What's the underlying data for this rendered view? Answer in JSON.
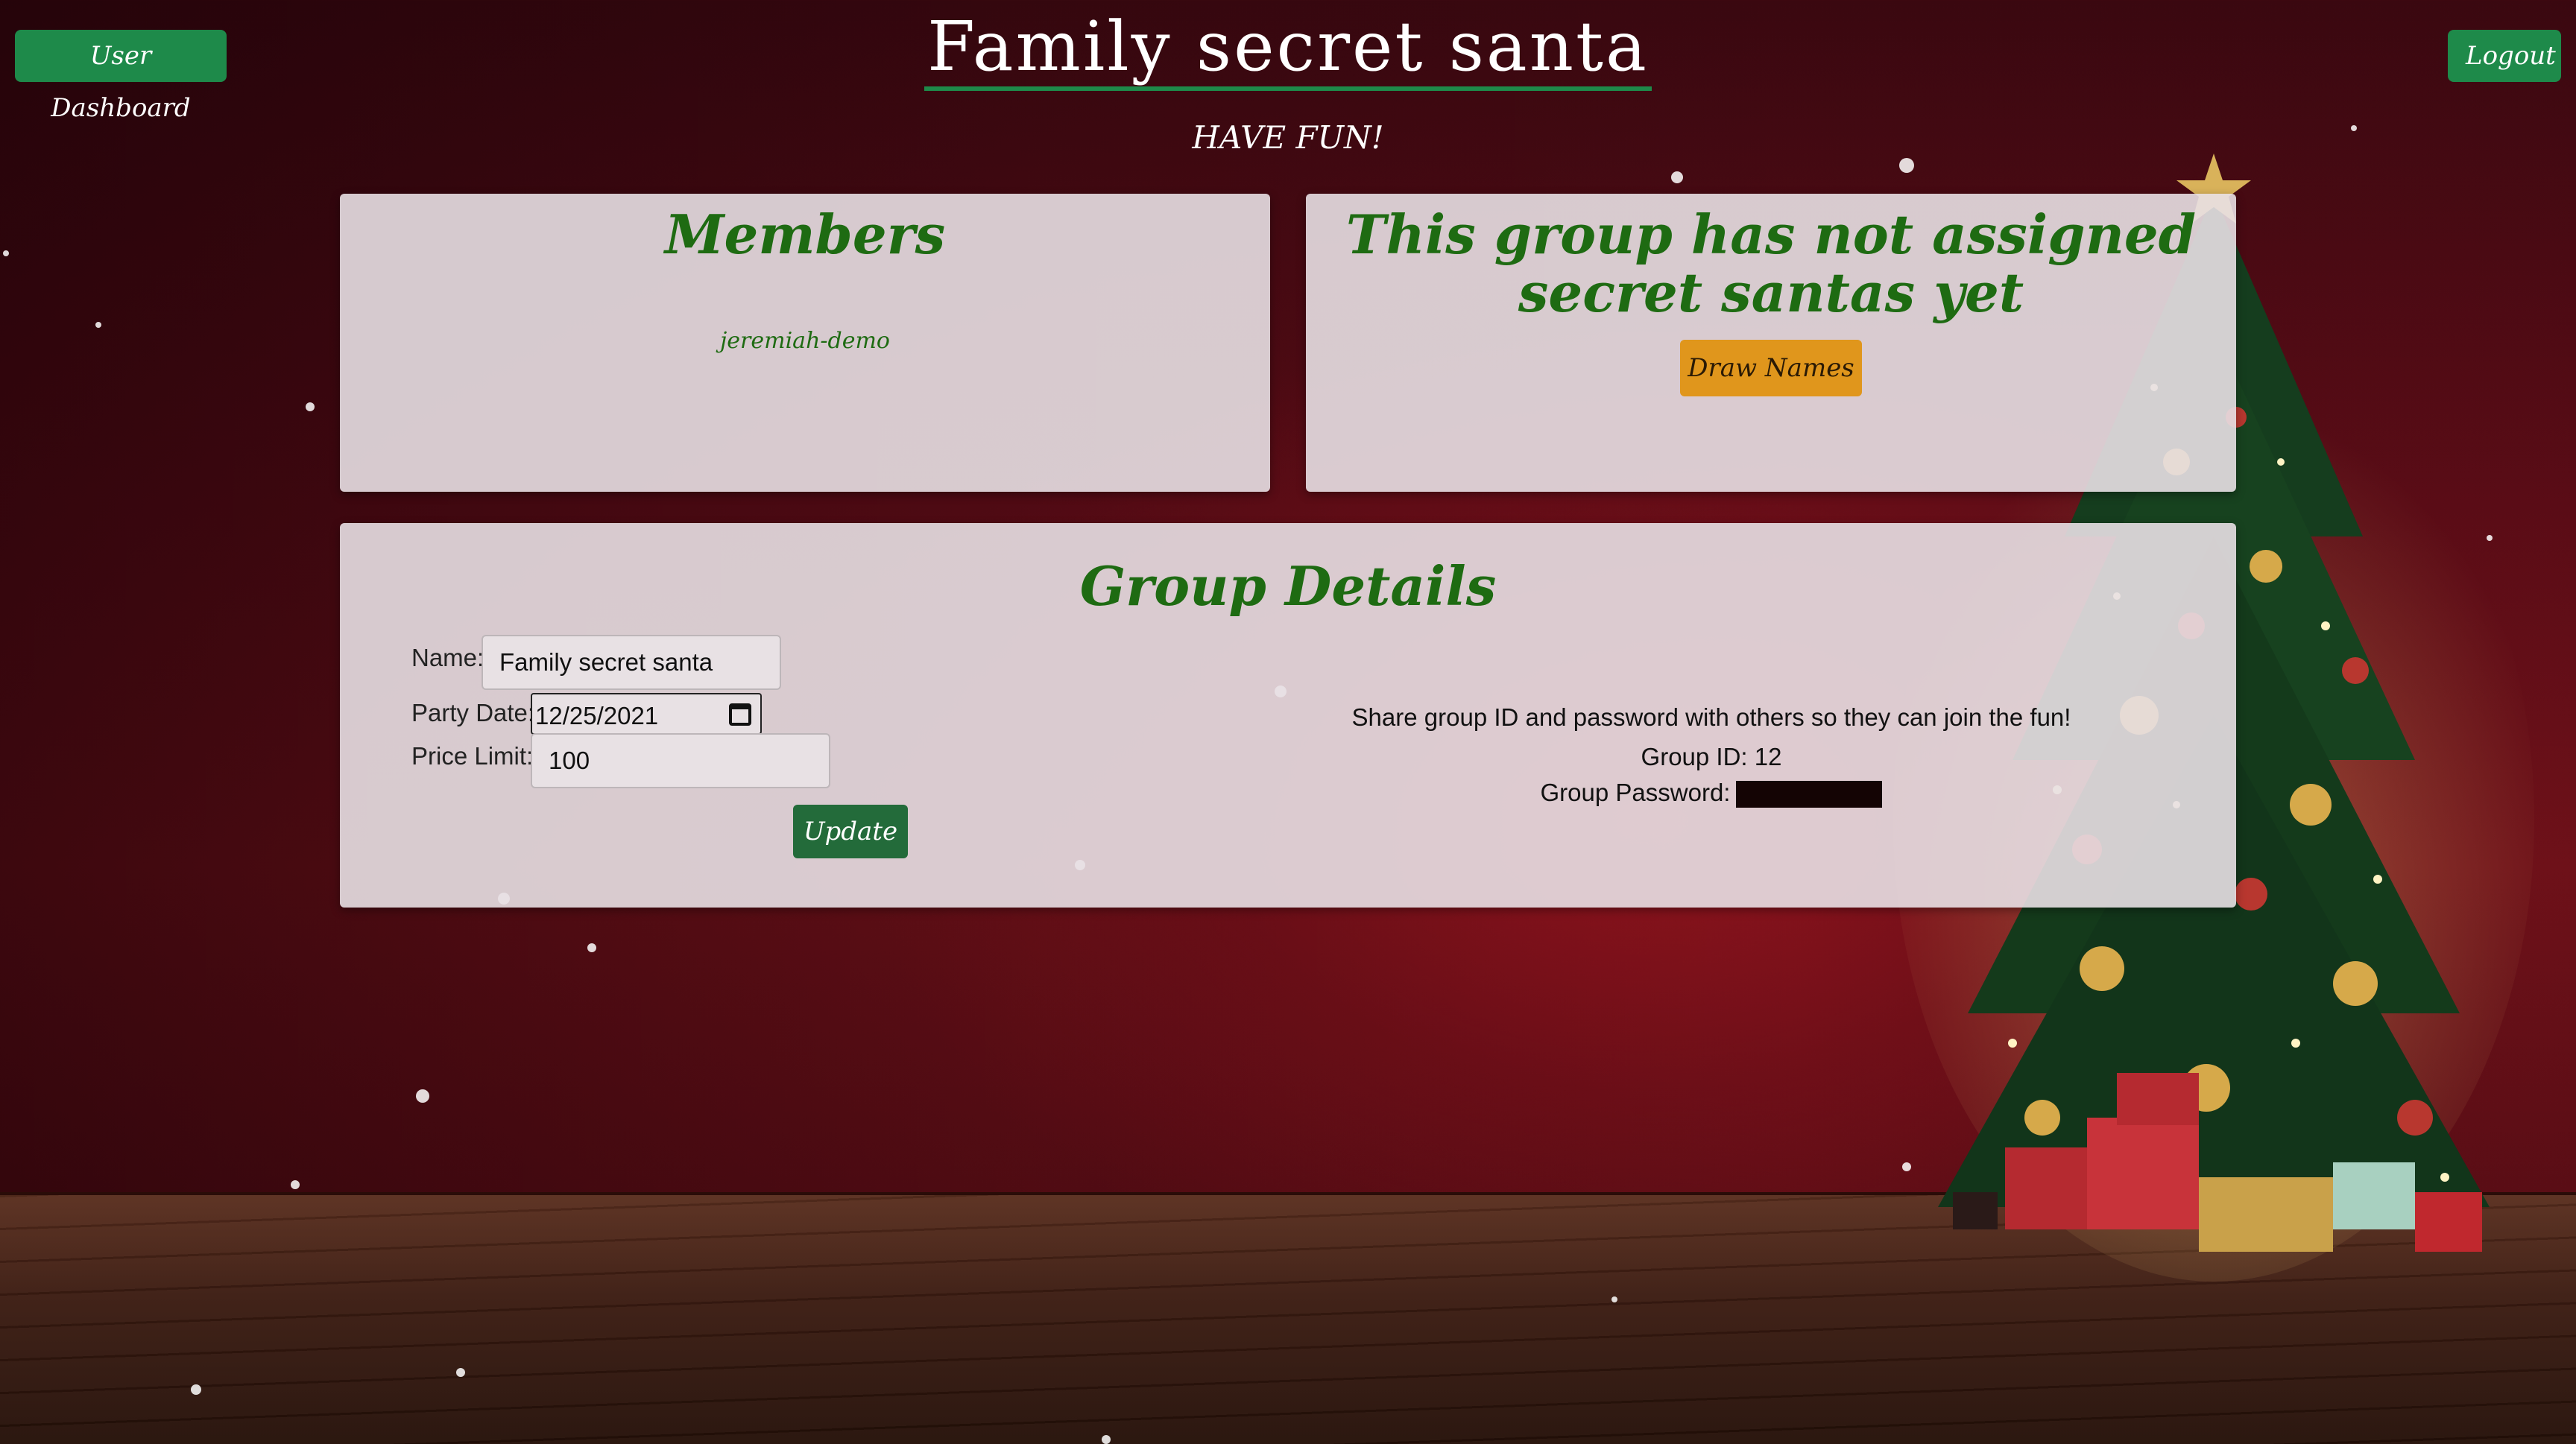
{
  "header": {
    "dashboard_label": "User Dashboard",
    "logout_label": "Logout",
    "title": "Family secret santa",
    "tagline": "HAVE FUN!"
  },
  "members_panel": {
    "heading": "Members",
    "members": [
      "jeremiah-demo"
    ]
  },
  "santas_panel": {
    "heading": "This group has not assigned secret santas yet",
    "draw_label": "Draw Names"
  },
  "details_panel": {
    "heading": "Group Details",
    "name_label": "Name:",
    "name_value": "Family secret santa",
    "date_label": "Party Date:",
    "date_value": "12/25/2021",
    "price_label": "Price Limit:",
    "price_value": "100",
    "update_label": "Update",
    "share_text": "Share group ID and password with others so they can join the fun!",
    "group_id_text": "Group ID: 12",
    "password_label": "Group Password:"
  },
  "colors": {
    "accent_green": "#1e8a4a",
    "heading_green": "#1e6b12",
    "draw_button": "#e0961c",
    "background_red": "#6e1119"
  }
}
